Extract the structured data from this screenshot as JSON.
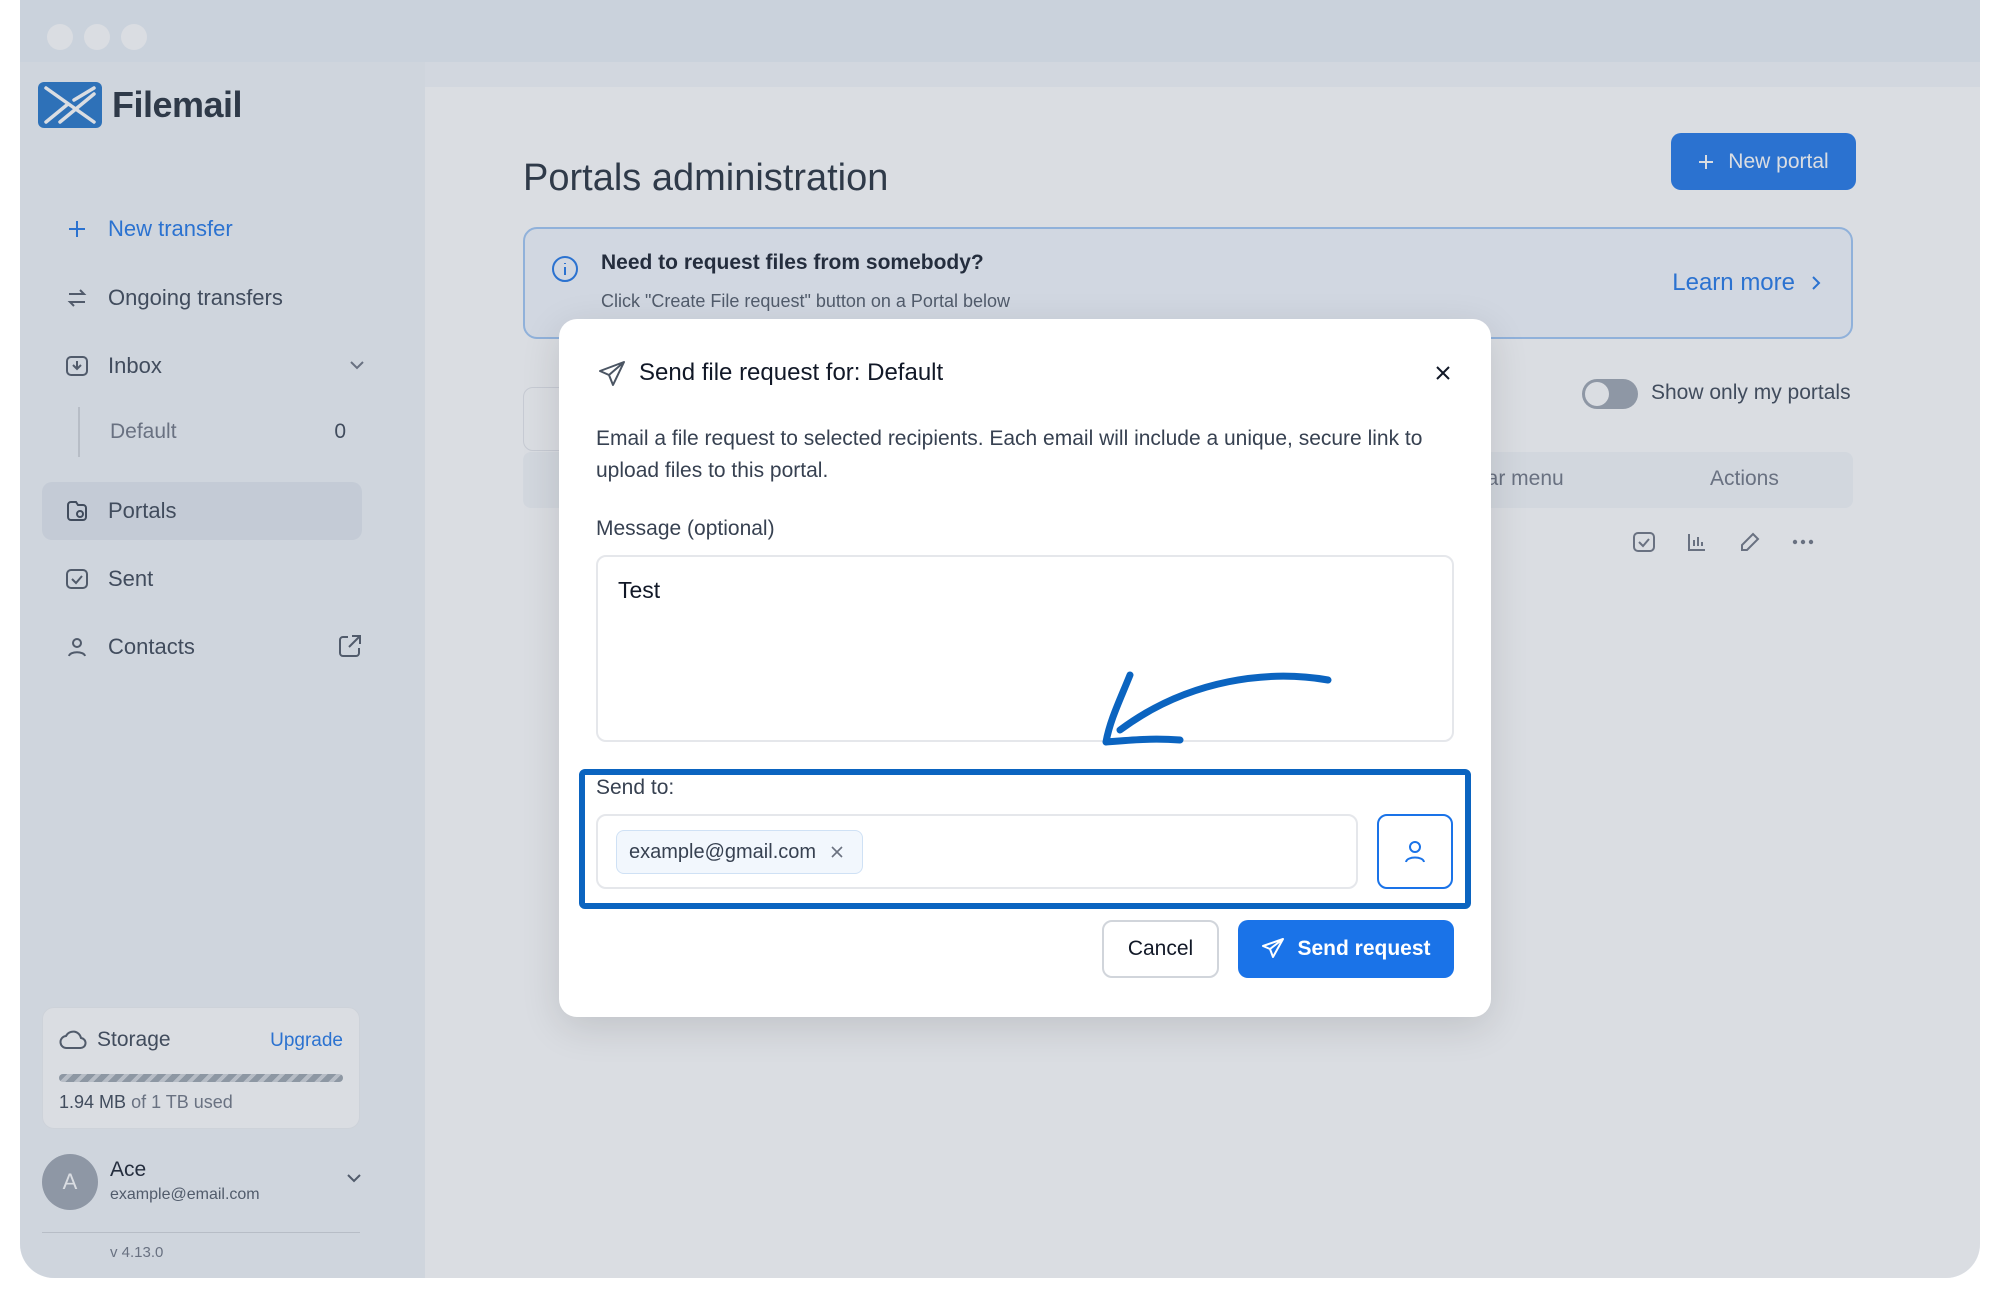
{
  "app": {
    "name": "Filemail"
  },
  "sidebar": {
    "new_transfer": "New transfer",
    "items": [
      {
        "label": "Ongoing transfers"
      },
      {
        "label": "Inbox"
      },
      {
        "label": "Portals"
      },
      {
        "label": "Sent"
      },
      {
        "label": "Contacts"
      }
    ],
    "inbox_sub": {
      "label": "Default",
      "count": "0"
    },
    "storage": {
      "label": "Storage",
      "upgrade": "Upgrade",
      "used_amount": "1.94 MB",
      "used_suffix": "of 1 TB used"
    },
    "user": {
      "initial": "A",
      "name": "Ace",
      "email": "example@email.com"
    },
    "version": "v 4.13.0"
  },
  "main": {
    "title": "Portals administration",
    "new_portal": "New portal",
    "banner": {
      "title": "Need to request files from somebody?",
      "text": "Click \"Create File request\" button on a Portal below",
      "link": "Learn more"
    },
    "toggle_label": "Show only my portals",
    "table": {
      "col_menu": "bar menu",
      "col_actions": "Actions"
    }
  },
  "modal": {
    "title": "Send file request for: Default",
    "description": "Email a file request to selected recipients. Each email will include a unique, secure link to upload files to this portal.",
    "message_label": "Message (optional)",
    "message_value": "Test",
    "send_to_label": "Send to:",
    "recipients": [
      "example@gmail.com"
    ],
    "cancel": "Cancel",
    "send": "Send request"
  },
  "colors": {
    "accent": "#1a73e8",
    "highlight": "#0b64c0",
    "sidebar_bg": "#f1f5f9"
  },
  "icons": [
    "plus-icon",
    "transfer-icon",
    "inbox-icon",
    "portal-icon",
    "sent-icon",
    "contact-icon",
    "external-link-icon",
    "cloud-icon",
    "info-icon",
    "chevron-right-icon",
    "send-icon",
    "close-icon",
    "user-icon"
  ]
}
